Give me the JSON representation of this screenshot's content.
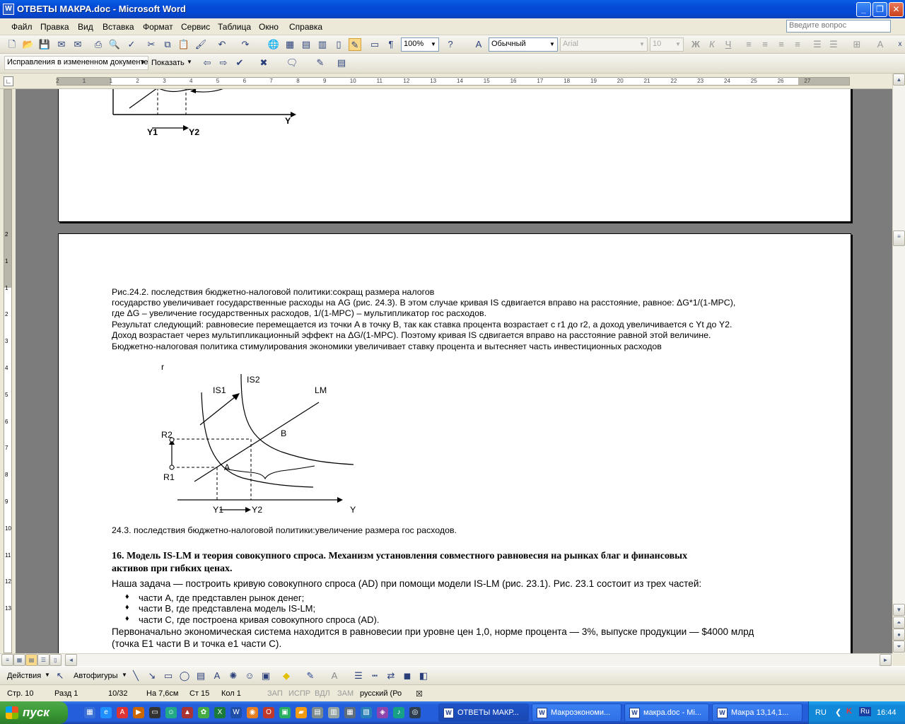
{
  "window": {
    "title": "ОТВЕТЫ МАКРА.doc - Microsoft Word",
    "app_icon": "W",
    "minimize": "_",
    "restore": "❐",
    "close": "✕"
  },
  "menu": {
    "items": [
      "Файл",
      "Правка",
      "Вид",
      "Вставка",
      "Формат",
      "Сервис",
      "Таблица",
      "Окно",
      "Справка"
    ],
    "ask_placeholder": "Введите вопрос"
  },
  "toolbar": {
    "zoom": "100%",
    "style": "Обычный",
    "font": "Arial",
    "font_size": "10",
    "bold": "Ж",
    "italic": "К",
    "underline": "Ч",
    "close_x": "x"
  },
  "review_toolbar": {
    "mode": "Исправления в измененном документе",
    "show": "Показать"
  },
  "ruler": {
    "ticks": [
      "2",
      "1",
      "1",
      "2",
      "3",
      "4",
      "5",
      "6",
      "7",
      "8",
      "9",
      "10",
      "11",
      "12",
      "13",
      "14",
      "15",
      "16",
      "17",
      "18",
      "19",
      "20",
      "21",
      "22",
      "23",
      "24",
      "25",
      "26",
      "27"
    ],
    "vticks": [
      "2",
      "1",
      "1",
      "2",
      "3",
      "4",
      "5",
      "6",
      "7",
      "8",
      "9",
      "10",
      "11",
      "12",
      "13"
    ]
  },
  "page1": {
    "graph_labels": {
      "y1": "Y1",
      "y2": "Y2",
      "y": "Y"
    }
  },
  "page2": {
    "caption_242": "Рис.24.2. последствия бюджетно-налоговой политики:сокращ размера налогов",
    "para1_line1": "государство увеличивает государственные расходы на AG (рис. 24.3). В этом случае кривая IS сдвигается вправо на расстояние, равное: ΔG*1/(1-MPC),",
    "para1_line2": "где ΔG – увеличение государственных расходов, 1/(1-MPC) – мультипликатор гос расходов.",
    "para2_line1": "Результат следующий: равновесие перемещается из точки A в точку B, так как ставка процента возрастает с r1 до r2, а доход увеличивается с Yt до Y2.",
    "para2_line2": "Доход возрастает через мультипликационный эффект на ΔG/(1-MPC). Поэтому кривая IS сдвигается вправо на расстояние равной этой величине.",
    "para2_line3": "Бюджетно-налоговая политика стимулирования экономики увеличивает ставку процента и вытесняет часть инвестиционных расходов",
    "graph": {
      "r": "r",
      "is1": "IS1",
      "is2": "IS2",
      "lm": "LM",
      "r2": "R2",
      "r1": "R1",
      "a": "A",
      "b": "B",
      "y1": "Y1",
      "y2": "Y2",
      "y": "Y"
    },
    "caption_243": "24.3. последствия бюджетно-налоговой политики:увеличение размера гос расходов.",
    "heading_line1": "16. Модель IS-LM и теория совокупного спроса. Механизм установления совместного равновесия на рынках благ и финансовых",
    "heading_line2": "активов при гибких ценах.",
    "intro": "Наша задача — построить кривую совокупного спроса (AD) при помощи модели IS-LM (рис. 23.1). Рис. 23.1 состоит из трех частей:",
    "bullets": [
      "части А, где представлен рынок денег;",
      "части В, где представлена модель IS-LM;",
      "части С, где построена кривая совокупного спроса (AD)."
    ],
    "last_line1": "Первоначально экономическая система находится в равновесии при уровне цен 1,0, норме процента — 3%, выпуске продукции — $4000 млрд",
    "last_line2": "(точка E1 части В и точка e1 части С)."
  },
  "drawbar": {
    "actions": "Действия",
    "autoshapes": "Автофигуры"
  },
  "status": {
    "page": "Стр. 10",
    "section": "Разд 1",
    "pages": "10/32",
    "at": "На 7,6см",
    "line": "Ст 15",
    "col": "Кол 1",
    "rec": "ЗАП",
    "trk": "ИСПР",
    "ext": "ВДЛ",
    "ovr": "ЗАМ",
    "lang": "русский (Ро"
  },
  "taskbar": {
    "start": "пуск",
    "tasks": [
      "ОТВЕТЫ МАКР...",
      "Макроэкономи...",
      "макра.doc - Mi...",
      "Макра 13,14,1..."
    ],
    "lang": "RU",
    "kb": "Ru",
    "time": "16:44"
  }
}
